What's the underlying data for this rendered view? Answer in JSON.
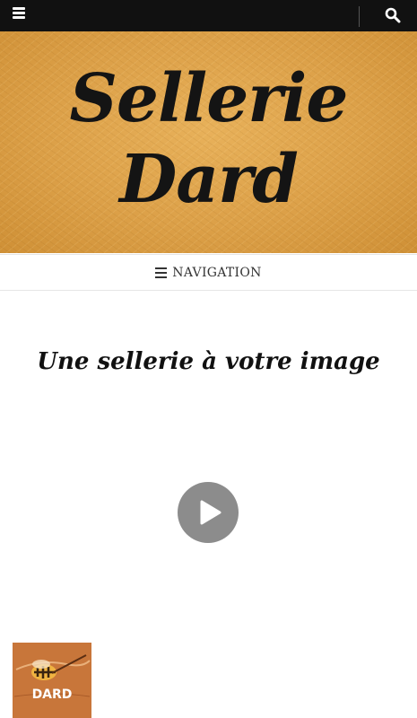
{
  "topbar": {
    "menu_icon": "hamburger-icon",
    "search_icon": "search-icon"
  },
  "hero": {
    "title_line1": "Sellerie",
    "title_line2": "Dard"
  },
  "navigation": {
    "label": "NAVIGATION",
    "icon": "hamburger-icon"
  },
  "content": {
    "tagline": "Une sellerie à votre image",
    "play_icon": "play-icon"
  },
  "logo": {
    "text": "DARD"
  },
  "colors": {
    "topbar_bg": "#111111",
    "hero_leather": "#dca048",
    "play_button": "#8c8c8c",
    "logo_leather": "#c8763a"
  }
}
